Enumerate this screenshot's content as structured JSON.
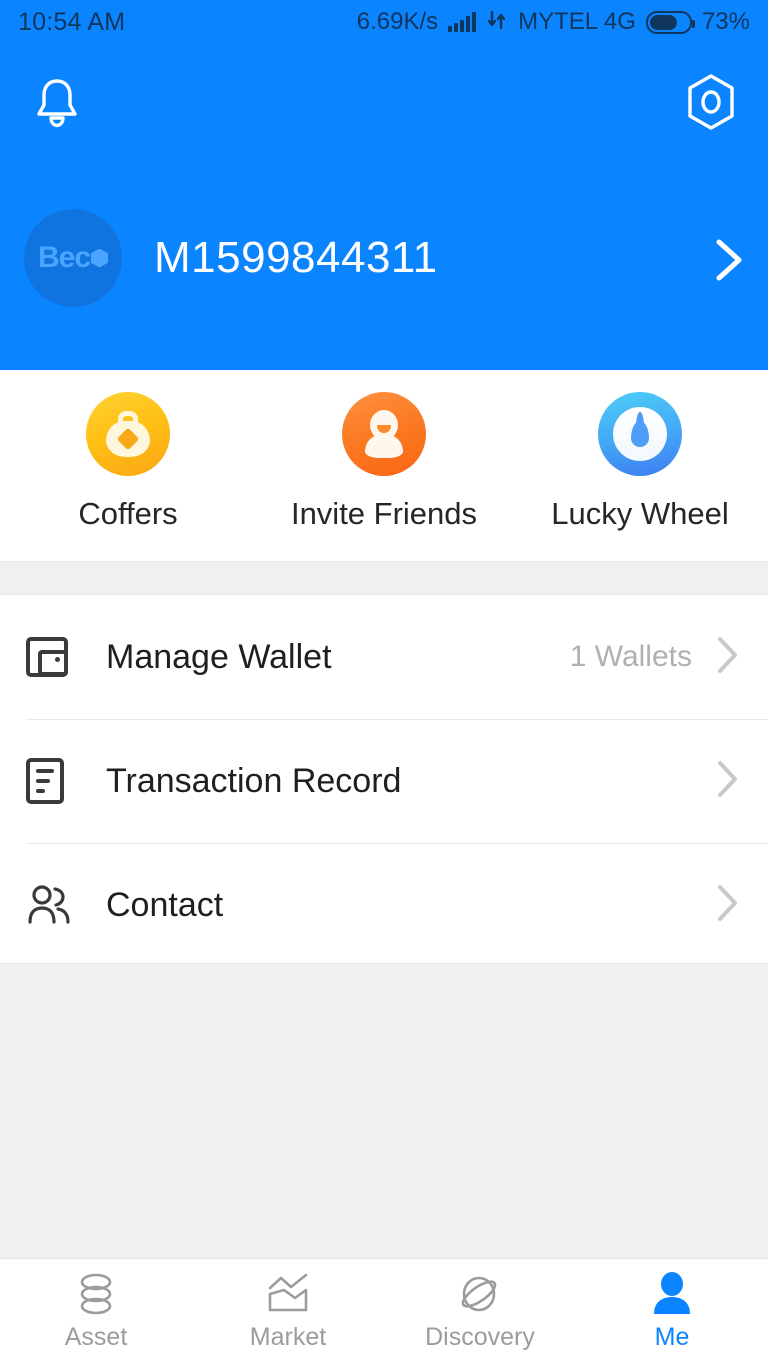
{
  "status_bar": {
    "time": "10:54 AM",
    "network_speed": "6.69K/s",
    "carrier": "MYTEL 4G",
    "battery_percent": "73%",
    "signal_icon": "signal-bars-icon",
    "data_icon": "data-transfer-icon",
    "battery_icon": "battery-icon"
  },
  "header": {
    "background_color": "#0a84ff",
    "notification_icon": "bell-icon",
    "settings_icon": "gear-hex-icon",
    "avatar_logo": "Bec",
    "avatar_icon": "avatar",
    "username": "M1599844311",
    "chevron_icon": "chevron-right-icon"
  },
  "shortcuts": [
    {
      "label": "Coffers",
      "icon": "money-bag-icon",
      "color": "#ffc015"
    },
    {
      "label": "Invite Friends",
      "icon": "person-invite-icon",
      "color": "#fb7b24"
    },
    {
      "label": "Lucky Wheel",
      "icon": "water-drop-icon",
      "color": "#42a6f5"
    }
  ],
  "menu": [
    {
      "label": "Manage Wallet",
      "value": "1 Wallets",
      "icon": "wallet-icon",
      "chevron": "chevron-right-icon"
    },
    {
      "label": "Transaction Record",
      "value": "",
      "icon": "document-lines-icon",
      "chevron": "chevron-right-icon"
    },
    {
      "label": "Contact",
      "value": "",
      "icon": "people-icon",
      "chevron": "chevron-right-icon"
    }
  ],
  "tabbar": {
    "active_color": "#0a84ff",
    "inactive_color": "#9c9c9c",
    "items": [
      {
        "label": "Asset",
        "icon": "coin-stack-icon",
        "active": false
      },
      {
        "label": "Market",
        "icon": "line-chart-icon",
        "active": false
      },
      {
        "label": "Discovery",
        "icon": "planet-icon",
        "active": false
      },
      {
        "label": "Me",
        "icon": "person-icon",
        "active": true
      }
    ]
  }
}
